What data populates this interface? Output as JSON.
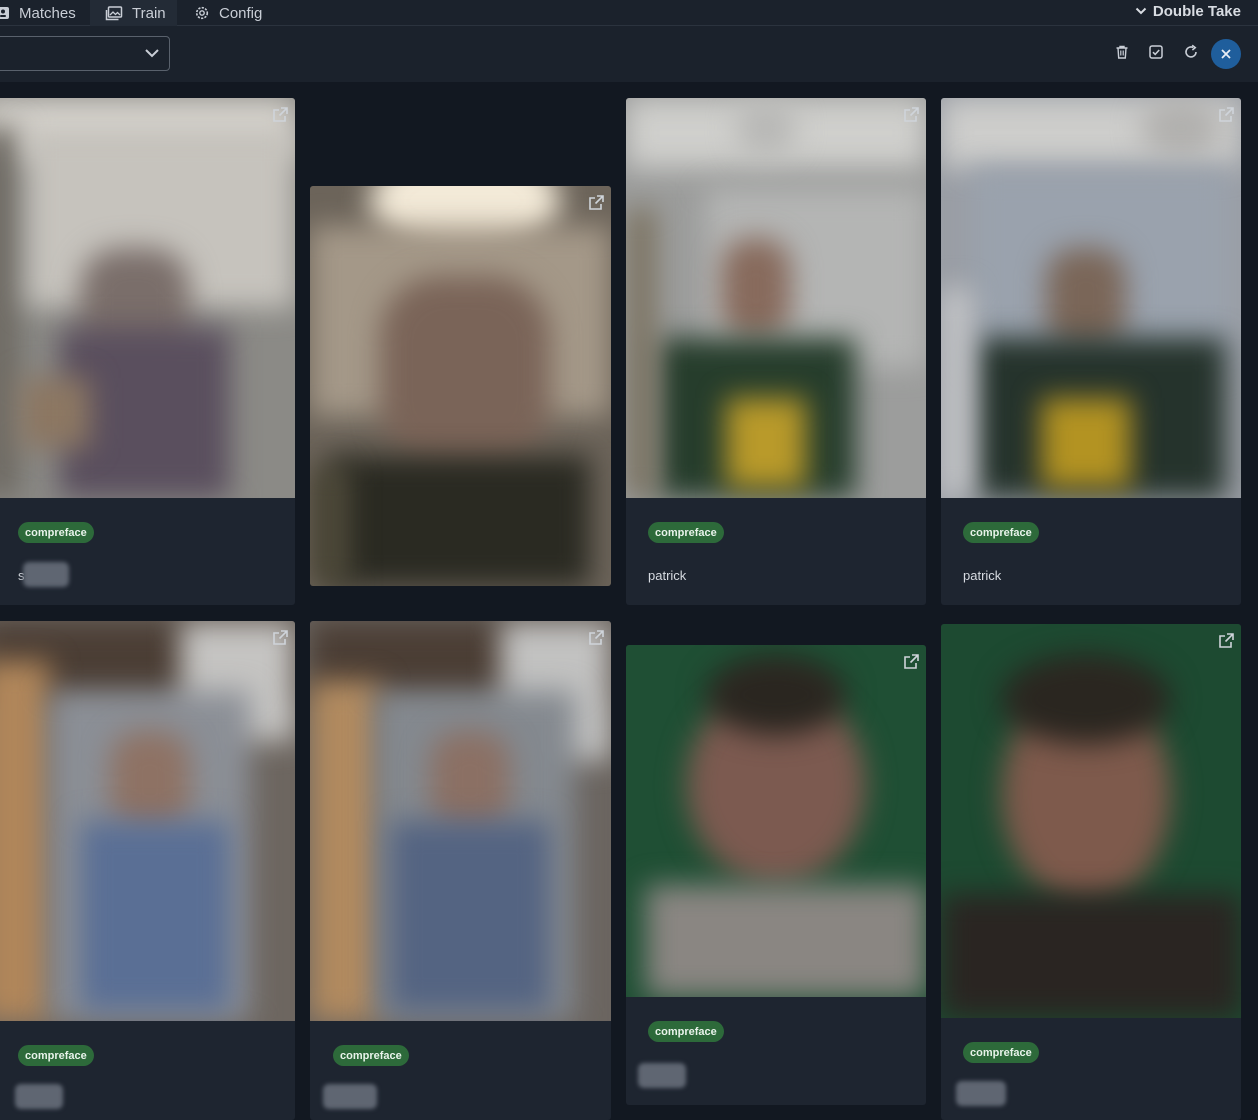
{
  "nav": {
    "tabs": [
      {
        "label": "Matches",
        "icon": "id-card-icon"
      },
      {
        "label": "Train",
        "icon": "images-icon"
      },
      {
        "label": "Config",
        "icon": "gear-icon"
      }
    ],
    "brand": "Double Take"
  },
  "toolbar": {
    "select_value": "",
    "actions": [
      "trash-icon",
      "check-square-icon",
      "refresh-icon",
      "close-icon"
    ],
    "accent": "#1f5e9c"
  },
  "cards": [
    {
      "detector": "compreface",
      "name": "s",
      "name_partially_redacted": true
    },
    {
      "detector": "",
      "name": ""
    },
    {
      "detector": "compreface",
      "name": "patrick"
    },
    {
      "detector": "compreface",
      "name": "patrick"
    },
    {
      "detector": "compreface",
      "name": "",
      "name_redacted": true
    },
    {
      "detector": "compreface",
      "name": "",
      "name_redacted": true
    },
    {
      "detector": "compreface",
      "name": "",
      "name_redacted": true
    },
    {
      "detector": "compreface",
      "name": "",
      "name_redacted": true
    }
  ],
  "colors": {
    "badge": "#2d6a3a",
    "background": "#121821",
    "card": "#1e2530"
  }
}
